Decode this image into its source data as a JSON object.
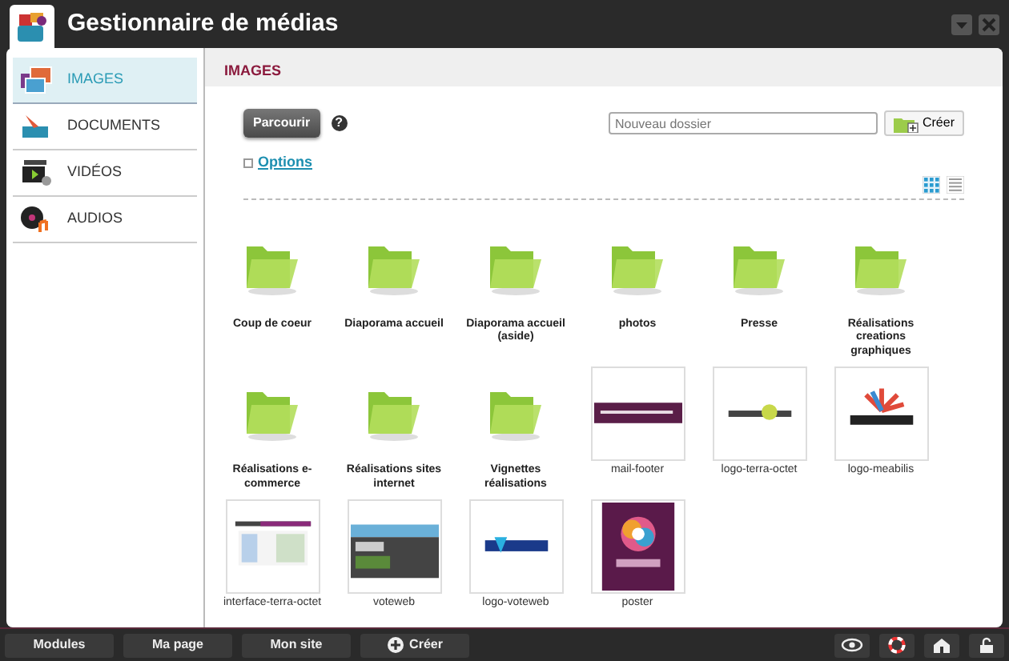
{
  "window": {
    "title": "Gestionnaire de médias"
  },
  "sidebar": {
    "items": [
      {
        "label": "IMAGES",
        "selected": true
      },
      {
        "label": "DOCUMENTS",
        "selected": false
      },
      {
        "label": "VIDÉOS",
        "selected": false
      },
      {
        "label": "AUDIOS",
        "selected": false
      }
    ]
  },
  "content": {
    "heading": "IMAGES",
    "browse_button": "Parcourir",
    "help": "?",
    "new_folder": {
      "placeholder": "Nouveau dossier"
    },
    "create_button": "Créer",
    "options_link": "Options",
    "view": {
      "grid_selected": true
    },
    "items": [
      {
        "kind": "folder",
        "label": "Coup de coeur"
      },
      {
        "kind": "folder",
        "label": "Diaporama accueil"
      },
      {
        "kind": "folder",
        "label": "Diaporama accueil (aside)"
      },
      {
        "kind": "folder",
        "label": "photos"
      },
      {
        "kind": "folder",
        "label": "Presse"
      },
      {
        "kind": "folder",
        "label": "Réalisations creations graphiques"
      },
      {
        "kind": "folder",
        "label": "Réalisations e-commerce"
      },
      {
        "kind": "folder",
        "label": "Réalisations sites internet"
      },
      {
        "kind": "folder",
        "label": "Vignettes réalisations"
      },
      {
        "kind": "picture",
        "label": "mail-footer"
      },
      {
        "kind": "picture",
        "label": "logo-terra-octet"
      },
      {
        "kind": "picture",
        "label": "logo-meabilis"
      },
      {
        "kind": "picture",
        "label": "interface-terra-octet"
      },
      {
        "kind": "picture",
        "label": "voteweb"
      },
      {
        "kind": "picture",
        "label": "logo-voteweb"
      },
      {
        "kind": "picture",
        "label": "poster"
      }
    ]
  },
  "bottom_bar": {
    "buttons": [
      "Modules",
      "Ma page",
      "Mon site"
    ],
    "create_button": "Créer"
  }
}
